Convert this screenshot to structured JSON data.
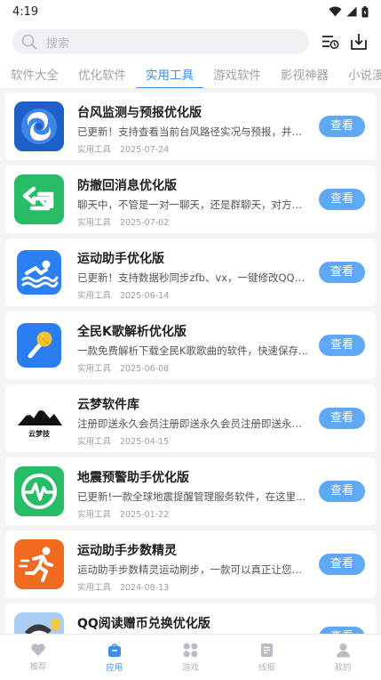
{
  "status_bar": {
    "time": "4:19"
  },
  "search": {
    "placeholder": "搜索"
  },
  "tabs": [
    {
      "label": "软件大全"
    },
    {
      "label": "优化软件"
    },
    {
      "label": "实用工具",
      "active": true
    },
    {
      "label": "游戏软件"
    },
    {
      "label": "影视神器"
    },
    {
      "label": "小说漫"
    }
  ],
  "apps": [
    {
      "title": "台风监测与预报优化版",
      "desc": "已更新！支持查看当前台风路径实况与预报，并且...",
      "category": "实用工具",
      "date": "2025-07-24",
      "button": "查看",
      "icon": "typhoon-icon"
    },
    {
      "title": "防撤回消息优化版",
      "desc": "聊天中，不管是一对一聊天，还是群聊天，对方突...",
      "category": "实用工具",
      "date": "2025-07-02",
      "button": "查看",
      "icon": "undo-arrow-icon"
    },
    {
      "title": "运动助手优化版",
      "desc": "已更新！支持数据秒同步zfb、vx，一键修改QQ运...",
      "category": "实用工具",
      "date": "2025-06-14",
      "button": "查看",
      "icon": "swimmer-icon"
    },
    {
      "title": "全民K歌解析优化版",
      "desc": "一款免费解析下载全民K歌歌曲的软件，快速保存...",
      "category": "实用工具",
      "date": "2025-06-08",
      "button": "查看",
      "icon": "microphone-icon"
    },
    {
      "title": "云梦软件库",
      "desc": "注册即送永久会员注册即送永久会员注册即送永久...",
      "category": "实用工具",
      "date": "2025-04-15",
      "button": "查看",
      "icon": "mountain-logo-icon",
      "icon_text": "云梦技"
    },
    {
      "title": "地震预警助手优化版",
      "desc": "已更新!一款全球地震提醒管理服务软件，在这里...",
      "category": "实用工具",
      "date": "2025-01-22",
      "button": "查看",
      "icon": "heartbeat-icon"
    },
    {
      "title": "运动助手步数精灵",
      "desc": "运动助手步数精灵运动刷步，一款可以真正让您成...",
      "category": "实用工具",
      "date": "2024-08-13",
      "button": "查看",
      "icon": "runner-icon"
    },
    {
      "title": "QQ阅读赠币兑换优化版",
      "desc": "",
      "category": "",
      "date": "",
      "button": "查看",
      "icon": "cartoon-avatar-icon"
    }
  ],
  "bottom_nav": [
    {
      "label": "推荐",
      "icon": "heart-icon"
    },
    {
      "label": "应用",
      "icon": "bag-icon",
      "active": true
    },
    {
      "label": "游戏",
      "icon": "grid-icon"
    },
    {
      "label": "线报",
      "icon": "document-icon"
    },
    {
      "label": "我的",
      "icon": "user-icon"
    }
  ],
  "colors": {
    "accent": "#3b8df2",
    "button": "#5ea8f6",
    "background": "#f3f4f6"
  }
}
